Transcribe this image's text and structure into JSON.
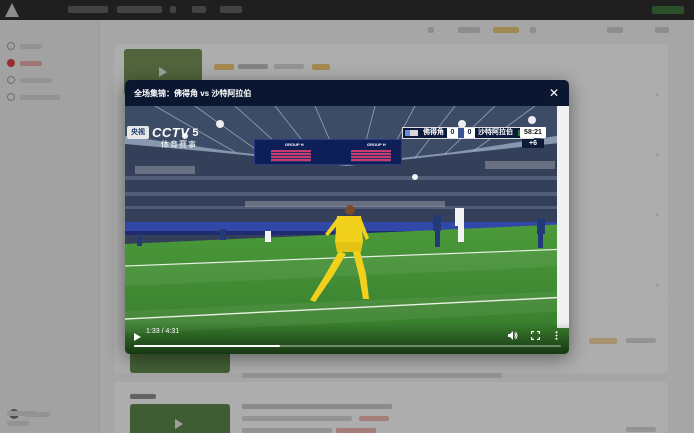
{
  "modal": {
    "title": "全场集锦：佛得角 vs 沙特阿拉伯",
    "close_icon": "close-icon"
  },
  "broadcast": {
    "channel_badge": "央视",
    "channel_name": "CCTV",
    "channel_number": "5",
    "channel_subtitle": "体育赛事",
    "home_team": "佛得角",
    "home_score": "0",
    "away_team": "沙特阿拉伯",
    "away_score": "0",
    "match_clock": "58:21",
    "added_time": "+6",
    "jumbotron_left": "GROUP H",
    "jumbotron_right": "GROUP H"
  },
  "player": {
    "current_time": "1:33",
    "separator": "/",
    "duration": "4:31",
    "progress_fraction": 0.343,
    "icons": [
      "play-icon",
      "volume-icon",
      "fullscreen-icon",
      "more-options-icon"
    ]
  },
  "colors": {
    "modal_bg": "#0b1730",
    "pitch_green": "#3f8a34",
    "keeper_yellow": "#f2d11c",
    "active_red": "#d8322c"
  }
}
